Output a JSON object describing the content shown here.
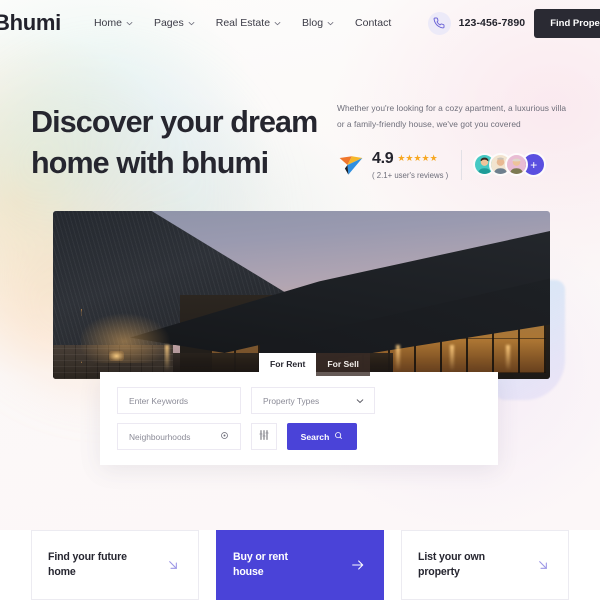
{
  "brand": {
    "logo": "Bhumi",
    "accent": "#4a43d8",
    "dark": "#2a2a33"
  },
  "header": {
    "nav": [
      {
        "label": "Home",
        "has_dropdown": true
      },
      {
        "label": "Pages",
        "has_dropdown": true
      },
      {
        "label": "Real Estate",
        "has_dropdown": true
      },
      {
        "label": "Blog",
        "has_dropdown": true
      },
      {
        "label": "Contact",
        "has_dropdown": false
      }
    ],
    "phone": "123-456-7890",
    "cta_label": "Find Property"
  },
  "hero": {
    "title_line1": "Discover your dream",
    "title_line2": "home with bhumi",
    "subtitle_line1": "Whether you're looking for a cozy apartment, a luxurious villa",
    "subtitle_line2": "or a family-friendly house, we've got you covered",
    "rating": {
      "score": "4.9",
      "stars": "★★★★★",
      "note": "( 2.1+ user's reviews )",
      "avatar_more": "+"
    }
  },
  "search": {
    "tabs": [
      {
        "label": "For Rent",
        "active": true
      },
      {
        "label": "For Sell",
        "active": false
      }
    ],
    "keywords_placeholder": "Enter Keywords",
    "property_types_value": "Property Types",
    "neighbourhoods_placeholder": "Neighbourhoods",
    "search_label": "Search"
  },
  "cards": [
    {
      "title_line1": "Find your future",
      "title_line2": "home",
      "accent": false,
      "arrow": "arrow-down-right"
    },
    {
      "title_line1": "Buy or rent",
      "title_line2": "house",
      "accent": true,
      "arrow": "arrow-right"
    },
    {
      "title_line1": "List your own",
      "title_line2": "property",
      "accent": false,
      "arrow": "arrow-down-right"
    }
  ]
}
